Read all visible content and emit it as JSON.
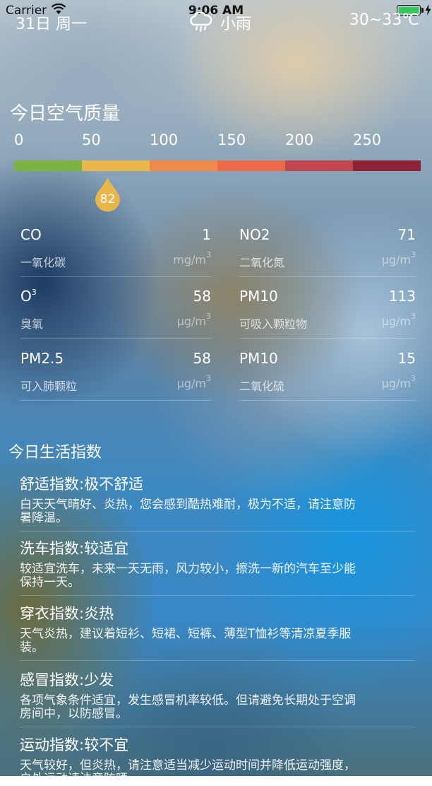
{
  "status_bar": {
    "carrier": "Carrier",
    "time": "9:06 AM"
  },
  "weather": {
    "date": "31日 周一",
    "condition": "小雨",
    "temperature": "30~33℃",
    "icon": "cloud-rain-icon"
  },
  "air_quality": {
    "title": "今日空气质量",
    "scale_labels": [
      "0",
      "50",
      "100",
      "150",
      "200",
      "250"
    ],
    "scale_colors": [
      "#7cb342",
      "#e8b84a",
      "#f08a4b",
      "#ea6a4a",
      "#c0464f",
      "#8e2336"
    ],
    "aqi_value": "82",
    "aqi_fraction": 0.23,
    "marker_color": "#e8b64c",
    "pollutants": [
      {
        "name": "CO",
        "value": "1",
        "cn": "一氧化碳",
        "unit": "mg/m",
        "unit_sup": "3"
      },
      {
        "name": "NO2",
        "value": "71",
        "cn": "二氧化氮",
        "unit": "μg/m",
        "unit_sup": "3"
      },
      {
        "name": "O",
        "name_sup": "3",
        "value": "58",
        "cn": "臭氧",
        "unit": "μg/m",
        "unit_sup": "3"
      },
      {
        "name": "PM10",
        "value": "113",
        "cn": "可吸入颗粒物",
        "unit": "μg/m",
        "unit_sup": "3"
      },
      {
        "name": "PM2.5",
        "value": "58",
        "cn": "可入肺颗粒",
        "unit": "μg/m",
        "unit_sup": "3"
      },
      {
        "name": "PM10",
        "value": "15",
        "cn": "二氧化硫",
        "unit": "μg/m",
        "unit_sup": "3"
      }
    ]
  },
  "life_index": {
    "title": "今日生活指数",
    "items": [
      {
        "title": "舒适指数:极不舒适",
        "lines": [
          "白天天气晴好、炎热，您会感到酷热难耐，极为不适，请注意防",
          "暑降温。"
        ]
      },
      {
        "title": "洗车指数:较适宜",
        "lines": [
          "较适宜洗车，未来一天无雨，风力较小，擦洗一新的汽车至少能",
          "保持一天。"
        ]
      },
      {
        "title": "穿衣指数:炎热",
        "lines": [
          "天气炎热，建议着短衫、短裙、短裤、薄型T恤衫等清凉夏季服",
          "装。"
        ]
      },
      {
        "title": "感冒指数:少发",
        "lines": [
          "各项气象条件适宜，发生感冒机率较低。但请避免长期处于空调",
          "房间中，以防感冒。"
        ]
      },
      {
        "title": "运动指数:较不宜",
        "lines": [
          "天气较好，但炎热，请注意适当减少运动时间并降低运动强度，",
          "户外运动请注意防晒。"
        ]
      }
    ]
  }
}
